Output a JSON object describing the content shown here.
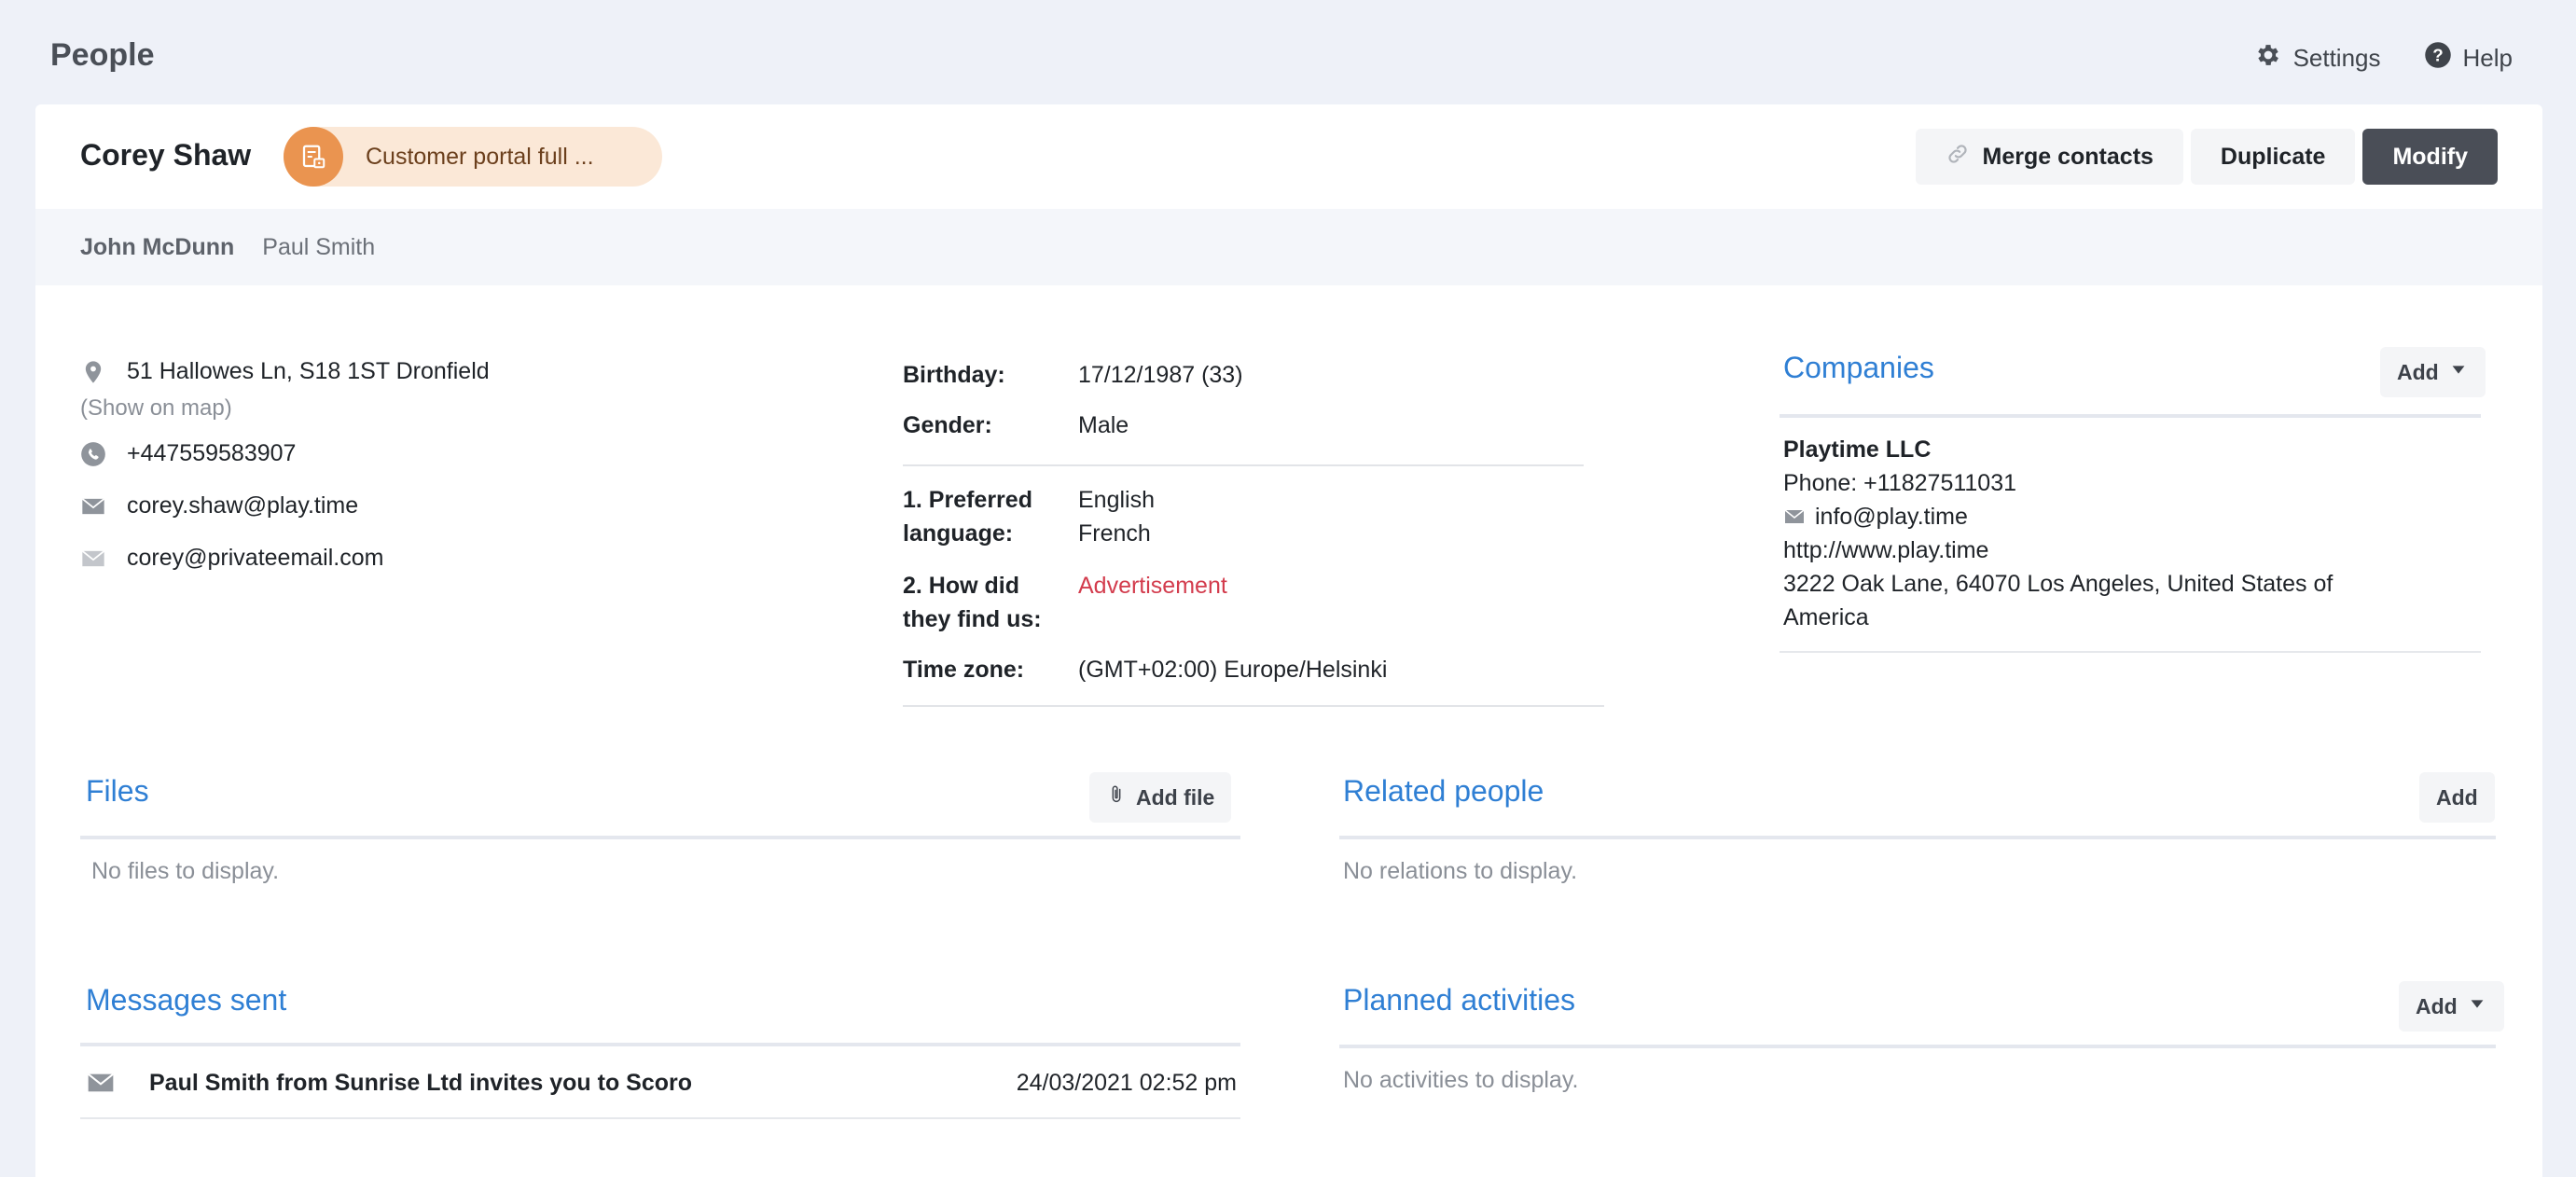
{
  "app": {
    "title": "People",
    "settings_label": "Settings",
    "help_label": "Help"
  },
  "person": {
    "name": "Corey Shaw",
    "badge_label": "Customer portal full ...",
    "actions": {
      "merge": "Merge contacts",
      "duplicate": "Duplicate",
      "modify": "Modify"
    },
    "tabs": [
      "John McDunn",
      "Paul Smith"
    ]
  },
  "contact": {
    "address": "51 Hallowes Ln, S18 1ST Dronfield",
    "show_on_map": "(Show on map)",
    "phone": "+447559583907",
    "email_primary": "corey.shaw@play.time",
    "email_secondary": "corey@privateemail.com"
  },
  "details": {
    "birthday_label": "Birthday:",
    "birthday_value": "17/12/1987 (33)",
    "gender_label": "Gender:",
    "gender_value": "Male",
    "pref_lang_label_1": "1. Preferred",
    "pref_lang_label_2": "language:",
    "pref_lang_value_1": "English",
    "pref_lang_value_2": "French",
    "found_label_1": "2. How did",
    "found_label_2": "they find us:",
    "found_value": "Advertisement",
    "timezone_label": "Time zone:",
    "timezone_value": "(GMT+02:00) Europe/Helsinki"
  },
  "companies": {
    "title": "Companies",
    "add_label": "Add",
    "name": "Playtime LLC",
    "phone": "Phone: +11827511031",
    "email": "info@play.time",
    "website": "http://www.play.time",
    "address_line1": "3222 Oak Lane, 64070 Los Angeles, United States of",
    "address_line2": "America"
  },
  "files": {
    "title": "Files",
    "add_label": "Add file",
    "empty": "No files to display."
  },
  "related": {
    "title": "Related people",
    "add_label": "Add",
    "empty": "No relations to display."
  },
  "messages": {
    "title": "Messages sent",
    "items": [
      {
        "subject": "Paul Smith from Sunrise Ltd invites you to Scoro",
        "date": "24/03/2021 02:52 pm"
      }
    ]
  },
  "activities": {
    "title": "Planned activities",
    "add_label": "Add",
    "empty": "No activities to display."
  },
  "colors": {
    "accent_blue": "#2f7fd4",
    "badge_orange": "#ea9450",
    "link_red": "#d33c4d",
    "primary_button": "#4a4e57"
  }
}
